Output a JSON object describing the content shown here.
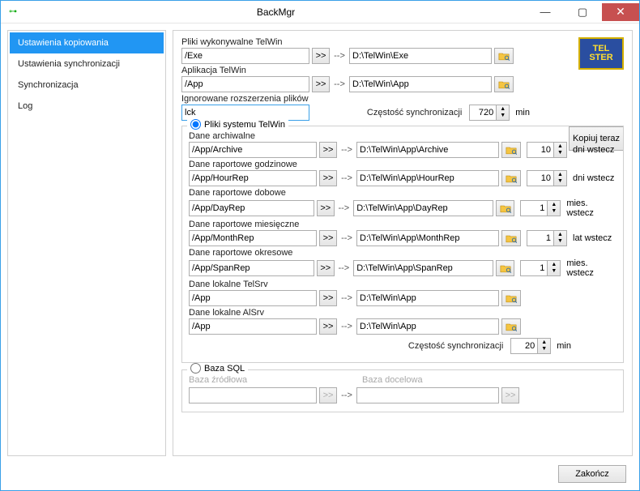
{
  "window": {
    "title": "BackMgr",
    "iconGlyph": "⊶"
  },
  "sidebar": {
    "items": [
      {
        "label": "Ustawienia kopiowania",
        "active": true
      },
      {
        "label": "Ustawienia synchronizacji"
      },
      {
        "label": "Synchronizacja"
      },
      {
        "label": "Log"
      }
    ]
  },
  "logo": "TEL\nSTER",
  "copyNow": "Kopiuj teraz",
  "close": "Zakończ",
  "top": {
    "exeLabel": "Pliki wykonywalne TelWin",
    "exeSrc": "/Exe",
    "exeDst": "D:\\TelWin\\Exe",
    "appLabel": "Aplikacja TelWin",
    "appSrc": "/App",
    "appDst": "D:\\TelWin\\App",
    "ignLabel": "Ignorowane rozszerzenia plików",
    "ignVal": "lck",
    "freqLabel": "Częstość synchronizacji",
    "freqVal": "720",
    "minUnit": "min"
  },
  "groupFiles": {
    "legend": "Pliki systemu TelWin",
    "items": [
      {
        "label": "Dane archiwalne",
        "src": "/App/Archive",
        "dst": "D:\\TelWin\\App\\Archive",
        "num": "10",
        "unit": "dni wstecz"
      },
      {
        "label": "Dane raportowe godzinowe",
        "src": "/App/HourRep",
        "dst": "D:\\TelWin\\App\\HourRep",
        "num": "10",
        "unit": "dni wstecz"
      },
      {
        "label": "Dane raportowe dobowe",
        "src": "/App/DayRep",
        "dst": "D:\\TelWin\\App\\DayRep",
        "num": "1",
        "unit": "mies. wstecz"
      },
      {
        "label": "Dane raportowe miesięczne",
        "src": "/App/MonthRep",
        "dst": "D:\\TelWin\\App\\MonthRep",
        "num": "1",
        "unit": "lat wstecz"
      },
      {
        "label": "Dane raportowe okresowe",
        "src": "/App/SpanRep",
        "dst": "D:\\TelWin\\App\\SpanRep",
        "num": "1",
        "unit": "mies. wstecz"
      },
      {
        "label": "Dane lokalne TelSrv",
        "src": "/App",
        "dst": "D:\\TelWin\\App"
      },
      {
        "label": "Dane lokalne AlSrv",
        "src": "/App",
        "dst": "D:\\TelWin\\App"
      }
    ],
    "freqLabel": "Częstość synchronizacji",
    "freqVal": "20",
    "minUnit": "min"
  },
  "groupSql": {
    "legend": "Baza SQL",
    "srcLabel": "Baza źródłowa",
    "dstLabel": "Baza docelowa"
  },
  "glyphs": {
    "chevrons": ">>",
    "arrow": "-->"
  }
}
